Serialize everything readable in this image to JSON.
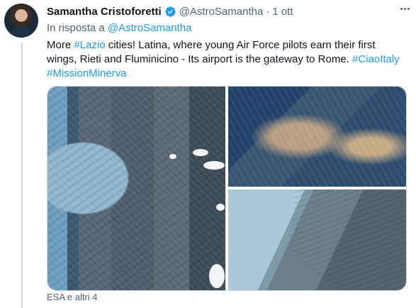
{
  "author": {
    "name": "Samantha Cristoforetti",
    "handle": "@AstroSamantha",
    "separator": "·",
    "time": "1 ott",
    "verified_color": "#1d9bf0"
  },
  "reply_context": {
    "prefix": "In risposta a",
    "handle": "@AstroSamantha"
  },
  "tweet": {
    "segments": [
      {
        "text": "More ",
        "link": false
      },
      {
        "text": "#Lazio",
        "link": true
      },
      {
        "text": " cities! Latina, where young Air Force pilots earn their first wings, Rieti and Fluminicino - Its airport is the gateway to Rome. ",
        "link": false
      },
      {
        "text": "#CiaoItaly",
        "link": true
      },
      {
        "text": " ",
        "link": false
      },
      {
        "text": "#MissionMinerva",
        "link": true
      }
    ]
  },
  "media": {
    "images": [
      "satellite-coast-latina",
      "satellite-mountains-rieti",
      "satellite-coast-fiumicino"
    ]
  },
  "tagged_users": "ESA e altri 4",
  "colors": {
    "link": "#1d9bf0",
    "secondary_text": "#536471",
    "border": "#cfd9de"
  }
}
